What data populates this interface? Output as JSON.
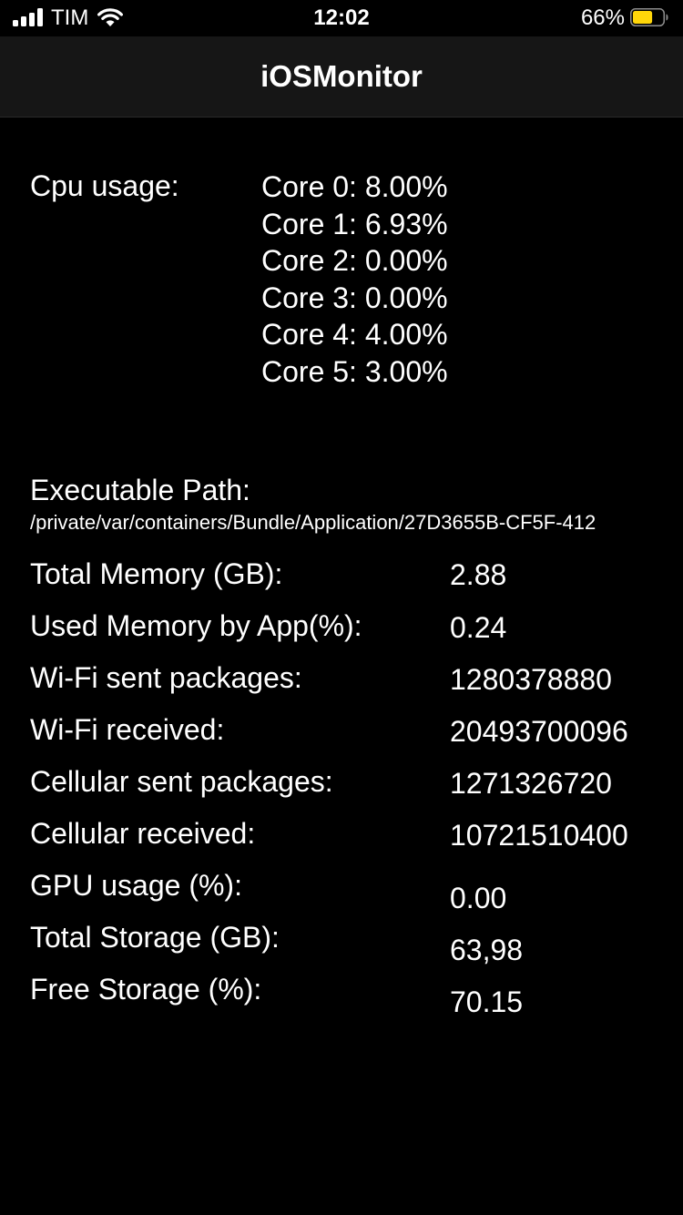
{
  "status_bar": {
    "carrier": "TIM",
    "time": "12:02",
    "battery_percent": "66%",
    "battery_level": 0.66,
    "battery_color": "#ffd60a",
    "signal_icon": "signal-bars-icon",
    "wifi_icon": "wifi-icon",
    "battery_icon": "battery-icon"
  },
  "nav": {
    "title": "iOSMonitor"
  },
  "cpu": {
    "label": "Cpu usage:",
    "cores": [
      "Core 0: 8.00%",
      "Core 1: 6.93%",
      "Core 2: 0.00%",
      "Core 3: 0.00%",
      "Core 4: 4.00%",
      "Core 5: 3.00%"
    ]
  },
  "executable": {
    "label": "Executable Path:",
    "path": "/private/var/containers/Bundle/Application/27D3655B-CF5F-412"
  },
  "stats": [
    {
      "label": "Total Memory (GB):",
      "value": "2.88"
    },
    {
      "label": "Used Memory by App(%):",
      "value": "0.24"
    },
    {
      "label": "Wi-Fi sent packages:",
      "value": "1280378880"
    },
    {
      "label": "Wi-Fi received:",
      "value": "20493700096"
    },
    {
      "label": "Cellular sent packages:",
      "value": "1271326720"
    },
    {
      "label": "Cellular received:",
      "value": "10721510400"
    },
    {
      "label": "GPU usage (%):",
      "value": "0.00"
    },
    {
      "label": "Total Storage (GB):",
      "value": "63,98"
    },
    {
      "label": "Free Storage (%):",
      "value": "70.15"
    }
  ]
}
